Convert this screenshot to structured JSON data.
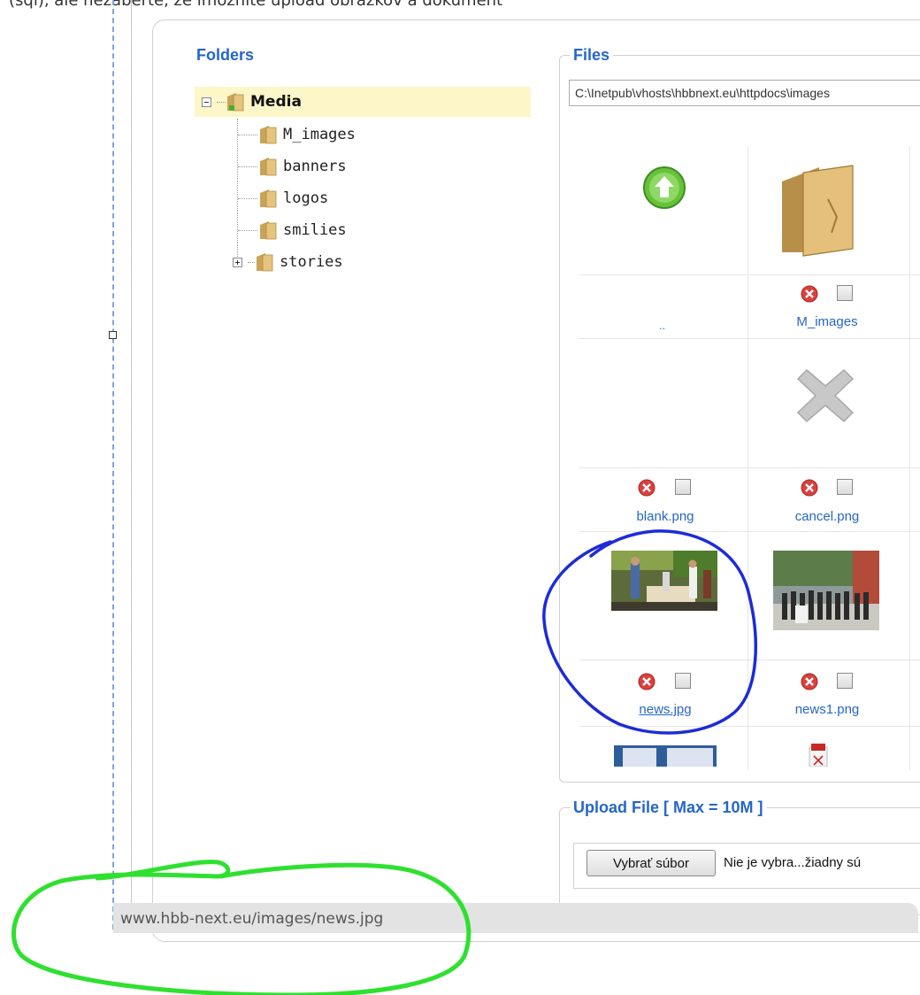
{
  "top_clip_text": "(sql), ale nezaberte, že imožnite upload obrázkov a dokument",
  "folders": {
    "title": "Folders",
    "root": "Media",
    "children": [
      "M_images",
      "banners",
      "logos",
      "smilies",
      "stories"
    ]
  },
  "files": {
    "legend": "Files",
    "path": "C:\\Inetpub\\vhosts\\hbbnext.eu\\httpdocs\\images",
    "up_label": "..",
    "items": [
      {
        "name": "M_images",
        "type": "folder"
      },
      {
        "name": "blank.png",
        "type": "image"
      },
      {
        "name": "cancel.png",
        "type": "image"
      },
      {
        "name": "news.jpg",
        "type": "image"
      },
      {
        "name": "news1.png",
        "type": "image"
      }
    ]
  },
  "upload": {
    "legend": "Upload File [ Max = 10M ]",
    "choose_label": "Vybrať súbor",
    "no_file_text": "Nie je vybra...žiadny sú"
  },
  "status_bar": {
    "url": "www.hbb-next.eu/images/news.jpg"
  },
  "annotations": {
    "blue_circle_color": "#1d2bd8",
    "green_circle_color": "#2fe02f"
  }
}
